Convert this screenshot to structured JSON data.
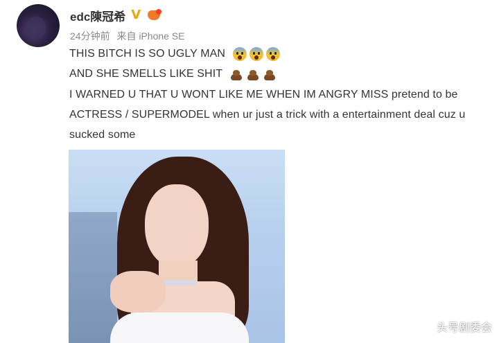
{
  "post": {
    "username": "edc陳冠希",
    "verified_mark": "V",
    "vip_badge_icon": "vip-heart-badge",
    "time": "24分钟前",
    "source": "来自 iPhone SE",
    "lines": [
      "THIS BITCH IS SO UGLY MAN",
      "AND SHE SMELLS LIKE SHIT",
      "I WARNED U THAT U WONT LIKE ME WHEN IM ANGRY MISS pretend to be",
      "ACTRESS / SUPERMODEL when ur just a trick with a entertainment deal cuz u",
      "sucked some"
    ],
    "line1_emojis": [
      "scream-emoji",
      "scream-emoji",
      "scream-emoji"
    ],
    "line2_emojis": [
      "poop-emoji",
      "poop-emoji",
      "poop-emoji"
    ],
    "photo_icon": "post-photo-woman-portrait"
  },
  "watermark": "头号剧委会"
}
